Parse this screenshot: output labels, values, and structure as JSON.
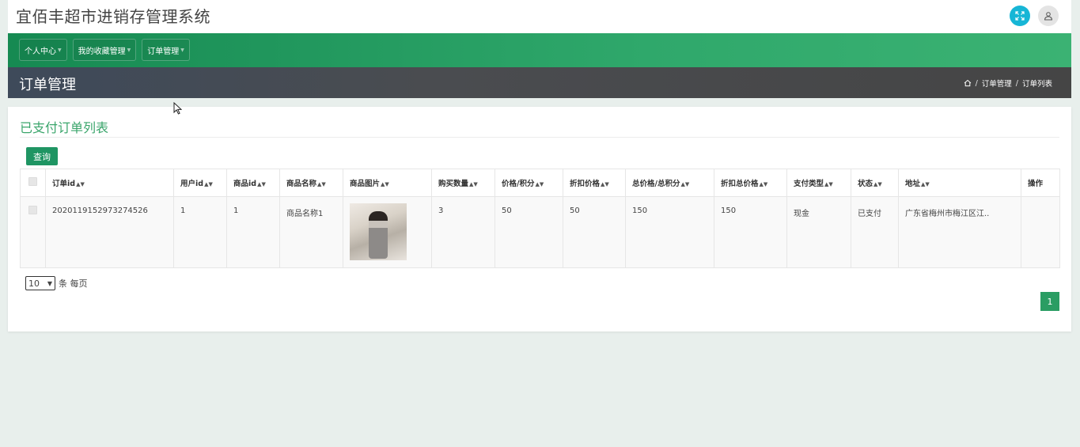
{
  "app": {
    "title": "宜佰丰超市进销存管理系统"
  },
  "topbar": {
    "fullscreen_icon": "fullscreen-icon",
    "user_icon": "user-icon",
    "accent": "#17b6d6"
  },
  "nav": {
    "items": [
      {
        "label": "个人中心"
      },
      {
        "label": "我的收藏管理"
      },
      {
        "label": "订单管理"
      }
    ]
  },
  "page": {
    "title": "订单管理"
  },
  "breadcrumb": {
    "home_icon": "home-icon",
    "items": [
      "订单管理",
      "订单列表"
    ]
  },
  "card": {
    "title": "已支付订单列表",
    "query_label": "查询",
    "title_color": "#3aa56b"
  },
  "table": {
    "columns": [
      "订单id",
      "用户id",
      "商品id",
      "商品名称",
      "商品图片",
      "购买数量",
      "价格/积分",
      "折扣价格",
      "总价格/总积分",
      "折扣总价格",
      "支付类型",
      "状态",
      "地址",
      "操作"
    ],
    "rows": [
      {
        "order_id": "2020119152973274526",
        "user_id": "1",
        "product_id": "1",
        "product_name": "商品名称1",
        "quantity": "3",
        "price": "50",
        "discount_price": "50",
        "total": "150",
        "discount_total": "150",
        "pay_type": "现金",
        "status": "已支付",
        "address": "广东省梅州市梅江区江..",
        "ops": ""
      }
    ]
  },
  "pager": {
    "page_size": "10",
    "per_page_label": "条 每页",
    "current_page": "1"
  }
}
